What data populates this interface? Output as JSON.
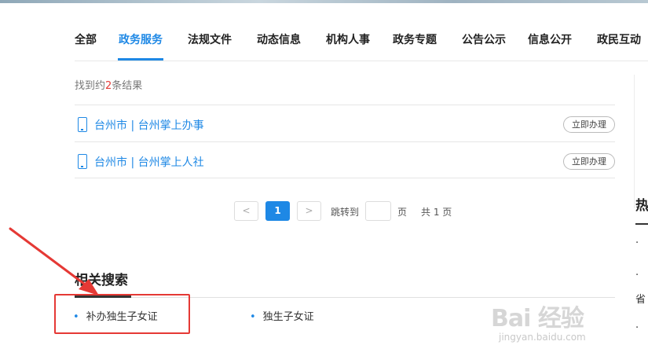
{
  "nav": {
    "tabs": [
      {
        "label": "全部",
        "active": false
      },
      {
        "label": "政务服务",
        "active": true
      },
      {
        "label": "法规文件",
        "active": false
      },
      {
        "label": "动态信息",
        "active": false
      },
      {
        "label": "机构人事",
        "active": false
      },
      {
        "label": "政务专题",
        "active": false
      },
      {
        "label": "公告公示",
        "active": false
      },
      {
        "label": "信息公开",
        "active": false
      },
      {
        "label": "政民互动",
        "active": false
      }
    ]
  },
  "results": {
    "count_prefix": "找到约",
    "count": "2",
    "count_suffix": "条结果",
    "items": [
      {
        "title": "台州市 | 台州掌上办事",
        "action": "立即办理",
        "icon": "mobile-phone-icon"
      },
      {
        "title": "台州市 | 台州掌上人社",
        "action": "立即办理",
        "icon": "mobile-phone-icon"
      }
    ]
  },
  "pagination": {
    "prev": "<",
    "current": "1",
    "next": ">",
    "jump_label": "跳转到",
    "jump_value": "",
    "page_unit": "页",
    "total": "共 1 页"
  },
  "related": {
    "title": "相关搜索",
    "items": [
      "补办独生子女证",
      "独生子女证"
    ]
  },
  "sidebar": {
    "title": "热",
    "items": [
      "·  ",
      "·  ",
      "省",
      "·  "
    ]
  },
  "annotation": {
    "color": "#e53935"
  },
  "watermark": {
    "logo": "Bai 经验",
    "sub": "jingyan.baidu.com"
  },
  "colors": {
    "accent": "#1e88e5",
    "highlight": "#e53935"
  }
}
